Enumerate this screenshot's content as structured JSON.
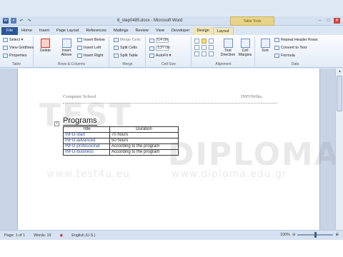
{
  "window": {
    "title": "8_step0485.docx - Microsoft Word",
    "contextual_tab_group": "Table Tools",
    "buttons": [
      "–",
      "□",
      "✕"
    ]
  },
  "qat": {
    "icons": [
      "word-icon",
      "save-icon",
      "undo-icon",
      "redo-icon"
    ]
  },
  "tabs": [
    {
      "label": "File"
    },
    {
      "label": "Home"
    },
    {
      "label": "Insert"
    },
    {
      "label": "Page Layout"
    },
    {
      "label": "References"
    },
    {
      "label": "Mailings"
    },
    {
      "label": "Review"
    },
    {
      "label": "View"
    },
    {
      "label": "Developer"
    },
    {
      "label": "Design"
    },
    {
      "label": "Layout"
    }
  ],
  "ribbon": {
    "table": {
      "label": "Table",
      "select": "Select ▾",
      "gridlines": "View Gridlines",
      "properties": "Properties"
    },
    "rows_columns": {
      "label": "Rows & Columns",
      "delete": "Delete",
      "insert_above": "Insert Above",
      "insert_below": "Insert Below",
      "insert_left": "Insert Left",
      "insert_right": "Insert Right"
    },
    "merge": {
      "label": "Merge",
      "merge_cells": "Merge Cells",
      "split_cells": "Split Cells",
      "split_table": "Split Table"
    },
    "cell_size": {
      "label": "Cell Size",
      "height": "0,4 cm",
      "width": "3,37 cm",
      "autofit": "AutoFit ▾"
    },
    "alignment": {
      "label": "Alignment",
      "text_direction": "Text Direction",
      "cell_margins": "Cell Margins"
    },
    "data": {
      "label": "Data",
      "sort": "Sort",
      "repeat_header": "Repeat Header Rows",
      "convert": "Convert to Text",
      "formula": "Formula"
    }
  },
  "document": {
    "header_left": "Computer School",
    "header_right": "INFOWhiz",
    "heading": "Programs",
    "table": {
      "headers": [
        "Title",
        "Duration"
      ],
      "rows": [
        [
          "INFO-start",
          "70 hours"
        ],
        [
          "INFO-advanced",
          "50 hours"
        ],
        [
          "INFO-professional",
          "According to the program"
        ],
        [
          "INFO-business",
          "According to the program"
        ]
      ]
    }
  },
  "watermark": {
    "line1": "TEST",
    "line2": "DIPLOMA",
    "url1": "www.test4u.eu",
    "url2": "www.diploma.edu.gr"
  },
  "statusbar": {
    "page": "Page: 1 of 1",
    "words": "Words: 19",
    "language": "English (U.S.)",
    "zoom": "100%"
  }
}
